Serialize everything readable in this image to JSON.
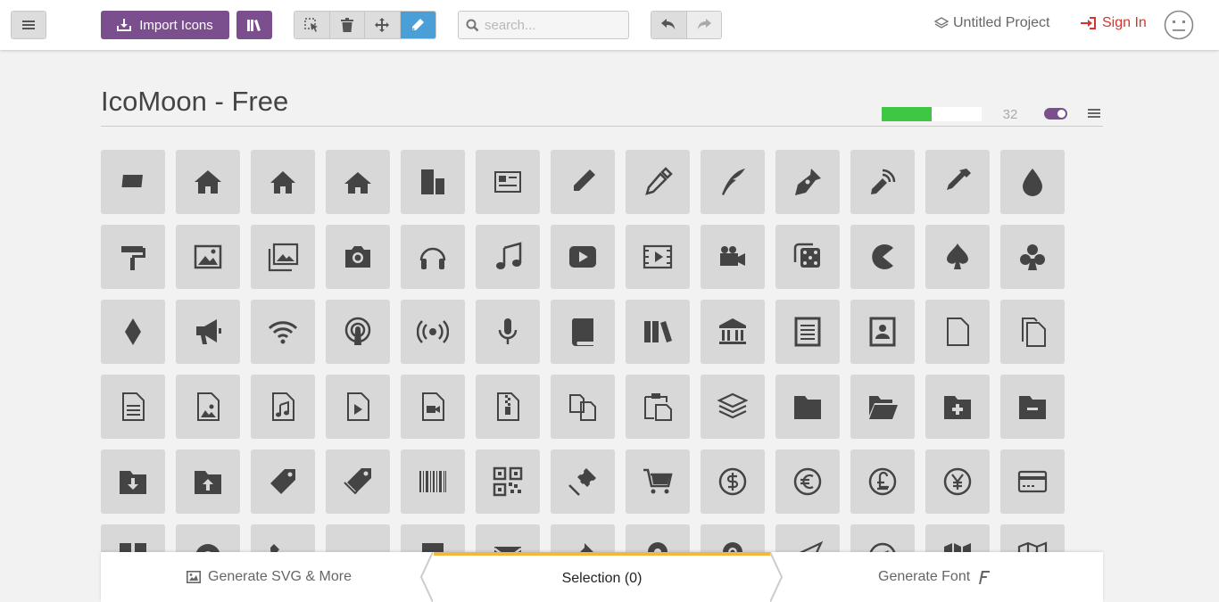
{
  "topbar": {
    "import_label": "Import Icons",
    "search_placeholder": "search...",
    "project_name": "Untitled Project",
    "signin_label": "Sign In"
  },
  "icon_set": {
    "title": "IcoMoon - Free",
    "count": "32",
    "progress_fraction": 0.5,
    "toggle_on": true,
    "accent_color": "#7b4f8e",
    "progress_color": "#3ec645",
    "icons": [
      "tile-icon",
      "home-icon",
      "home2-icon",
      "home3-icon",
      "office-icon",
      "newspaper-icon",
      "pencil-icon",
      "pencil2-icon",
      "quill-icon",
      "pen-icon",
      "blog-icon",
      "eyedropper-icon",
      "droplet-icon",
      "paint-format-icon",
      "image-icon",
      "images-icon",
      "camera-icon",
      "headphones-icon",
      "music-icon",
      "play-icon",
      "film-icon",
      "video-camera-icon",
      "dice-icon",
      "pacman-icon",
      "spades-icon",
      "clubs-icon",
      "diamonds-icon",
      "bullhorn-icon",
      "connection-icon",
      "podcast-icon",
      "feed-icon",
      "mic-icon",
      "book-icon",
      "books-icon",
      "library-icon",
      "file-text-icon",
      "profile-icon",
      "file-empty-icon",
      "files-empty-icon",
      "file-text2-icon",
      "file-picture-icon",
      "file-music-icon",
      "file-play-icon",
      "file-video-icon",
      "file-zip-icon",
      "copy-icon",
      "paste-icon",
      "stack-icon",
      "folder-icon",
      "folder-open-icon",
      "folder-plus-icon",
      "folder-minus-icon",
      "folder-download-icon",
      "folder-upload-icon",
      "price-tag-icon",
      "price-tags-icon",
      "barcode-icon",
      "qrcode-icon",
      "ticket-icon",
      "cart-icon",
      "coin-dollar-icon",
      "coin-euro-icon",
      "coin-pound-icon",
      "coin-yen-icon",
      "credit-card-icon",
      "calculator-icon",
      "lifebuoy-icon",
      "phone-icon",
      "phone-hang-up-icon",
      "address-book-icon",
      "envelop-icon",
      "pushpin-icon",
      "location-icon",
      "location2-icon",
      "compass-icon",
      "compass2-icon",
      "map-icon",
      "map2-icon"
    ]
  },
  "footer": {
    "generate_svg_label": "Generate SVG & More",
    "selection_label": "Selection (0)",
    "generate_font_label": "Generate Font"
  }
}
